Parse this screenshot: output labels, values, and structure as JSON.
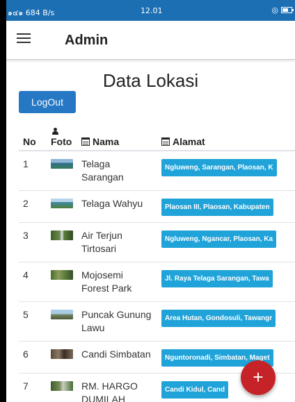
{
  "status": {
    "signal": "๑๔๑",
    "speed": "684 B/s",
    "time": "12.01"
  },
  "appbar": {
    "title": "Admin"
  },
  "page": {
    "heading": "Data Lokasi",
    "logout_label": "LogOut"
  },
  "table": {
    "headers": {
      "no": "No",
      "foto": "Foto",
      "nama": "Nama",
      "alamat": "Alamat"
    },
    "rows": [
      {
        "no": "1",
        "nama": "Telaga Sarangan",
        "alamat": "Ngluweng, Sarangan, Plaosan, K"
      },
      {
        "no": "2",
        "nama": "Telaga Wahyu",
        "alamat": "Plaosan III, Plaosan, Kabupaten"
      },
      {
        "no": "3",
        "nama": "Air Terjun Tirtosari",
        "alamat": "Ngluweng, Ngancar, Plaosan, Ka"
      },
      {
        "no": "4",
        "nama": "Mojosemi Forest Park",
        "alamat": "Jl. Raya Telaga Sarangan, Tawa"
      },
      {
        "no": "5",
        "nama": "Puncak Gunung Lawu",
        "alamat": "Area Hutan, Gondosuli, Tawangr"
      },
      {
        "no": "6",
        "nama": "Candi Simbatan",
        "alamat": "Nguntoronadi, Simbatan, Maget"
      },
      {
        "no": "7",
        "nama": "RM. HARGO DUMILAH",
        "alamat": "Candi Kidul, Cand"
      }
    ]
  },
  "fab": {
    "label": "+"
  },
  "colors": {
    "primary": "#2778c4",
    "badge": "#1fa3d9",
    "fab": "#c62328",
    "statusbar": "#1c6fb3"
  }
}
